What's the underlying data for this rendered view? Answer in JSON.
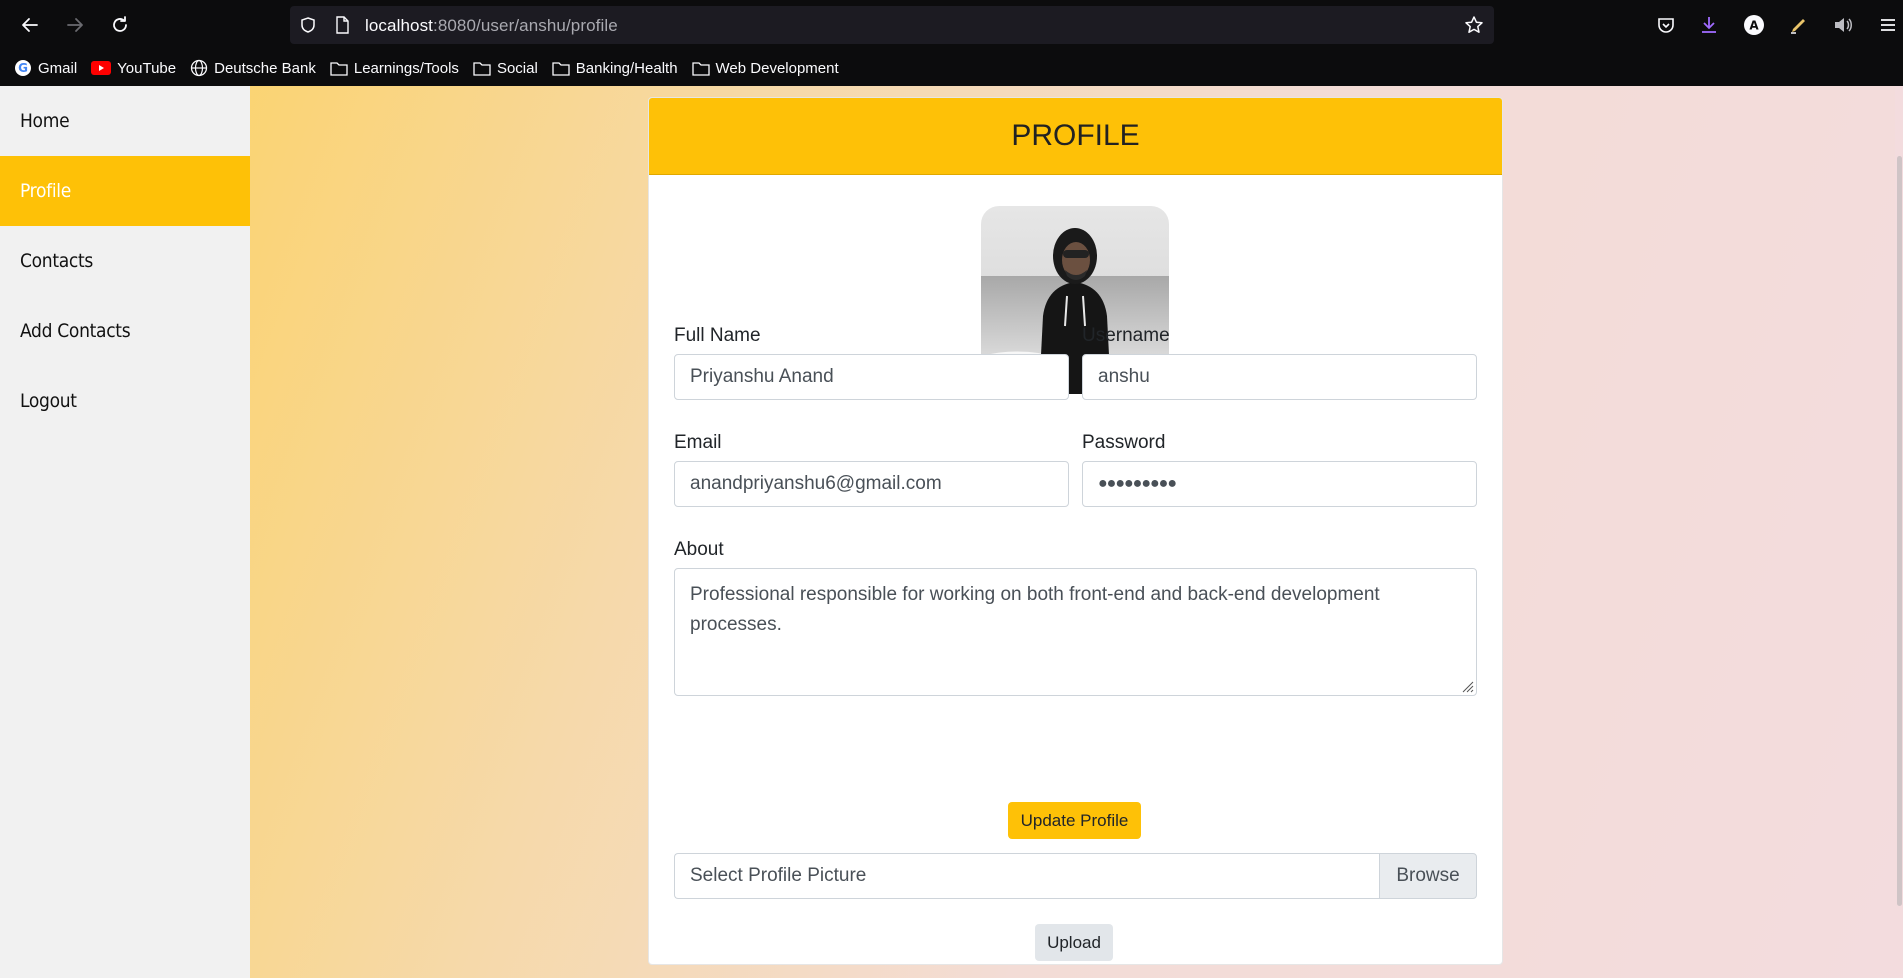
{
  "browser": {
    "url_host": "localhost",
    "url_path": ":8080/user/anshu/profile",
    "bookmarks": [
      {
        "label": "Gmail",
        "icon": "google-icon"
      },
      {
        "label": "YouTube",
        "icon": "youtube-icon"
      },
      {
        "label": "Deutsche Bank",
        "icon": "globe-icon"
      },
      {
        "label": "Learnings/Tools",
        "icon": "folder-icon"
      },
      {
        "label": "Social",
        "icon": "folder-icon"
      },
      {
        "label": "Banking/Health",
        "icon": "folder-icon"
      },
      {
        "label": "Web Development",
        "icon": "folder-icon"
      }
    ]
  },
  "sidebar": {
    "items": [
      {
        "label": "Home",
        "active": false
      },
      {
        "label": "Profile",
        "active": true
      },
      {
        "label": "Contacts",
        "active": false
      },
      {
        "label": "Add Contacts",
        "active": false
      },
      {
        "label": "Logout",
        "active": false
      }
    ]
  },
  "profile": {
    "title": "PROFILE",
    "full_name_label": "Full Name",
    "full_name_value": "Priyanshu Anand",
    "username_label": "Username",
    "username_value": "anshu",
    "email_label": "Email",
    "email_value": "anandpriyanshu6@gmail.com",
    "password_label": "Password",
    "password_value": "●●●●●●●●●",
    "about_label": "About",
    "about_value": "Professional responsible for working on both front-end and back-end development processes.",
    "update_button": "Update Profile",
    "file_placeholder": "Select Profile Picture",
    "browse_button": "Browse",
    "upload_button": "Upload"
  },
  "colors": {
    "accent": "#fec107",
    "sidebar_bg": "#f1f1f1",
    "chrome_bg": "#0c0c0d"
  }
}
